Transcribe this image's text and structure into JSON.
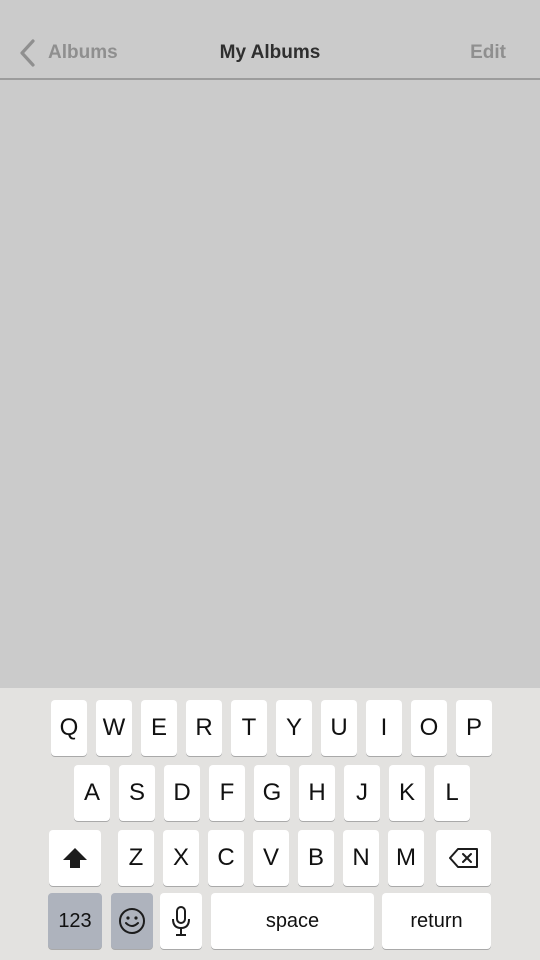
{
  "navbar": {
    "back_label": "Albums",
    "title": "My Albums",
    "edit_label": "Edit"
  },
  "keyboard": {
    "row1": [
      "Q",
      "W",
      "E",
      "R",
      "T",
      "Y",
      "U",
      "I",
      "O",
      "P"
    ],
    "row2": [
      "A",
      "S",
      "D",
      "F",
      "G",
      "H",
      "J",
      "K",
      "L"
    ],
    "row3": [
      "Z",
      "X",
      "C",
      "V",
      "B",
      "N",
      "M"
    ],
    "numbers_label": "123",
    "space_label": "space",
    "return_label": "return",
    "icons": {
      "shift": "shift-icon",
      "delete": "backspace-icon",
      "emoji": "emoji-icon",
      "mic": "microphone-icon",
      "back": "chevron-left-icon"
    }
  },
  "colors": {
    "background": "#cbcbcb",
    "keyboard_bg": "#e3e2e0",
    "key_bg": "#ffffff",
    "key_dark_bg": "#aeb3bd",
    "nav_inactive": "#8f8f8f",
    "nav_title": "#2f2f2f"
  }
}
